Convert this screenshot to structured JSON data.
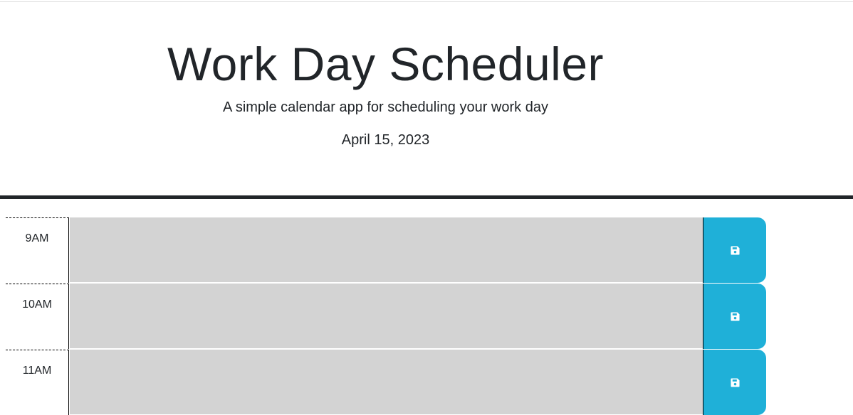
{
  "header": {
    "title": "Work Day Scheduler",
    "subtitle": "A simple calendar app for scheduling your work day",
    "date": "April 15, 2023"
  },
  "schedule": {
    "rows": [
      {
        "hour": "9AM",
        "description": "",
        "save_icon": "save-icon"
      },
      {
        "hour": "10AM",
        "description": "",
        "save_icon": "save-icon"
      },
      {
        "hour": "11AM",
        "description": "",
        "save_icon": "save-icon"
      }
    ]
  },
  "colors": {
    "past_row": "#d3d3d3",
    "save_button": "#1fb0d8",
    "header_rule": "#212529"
  }
}
